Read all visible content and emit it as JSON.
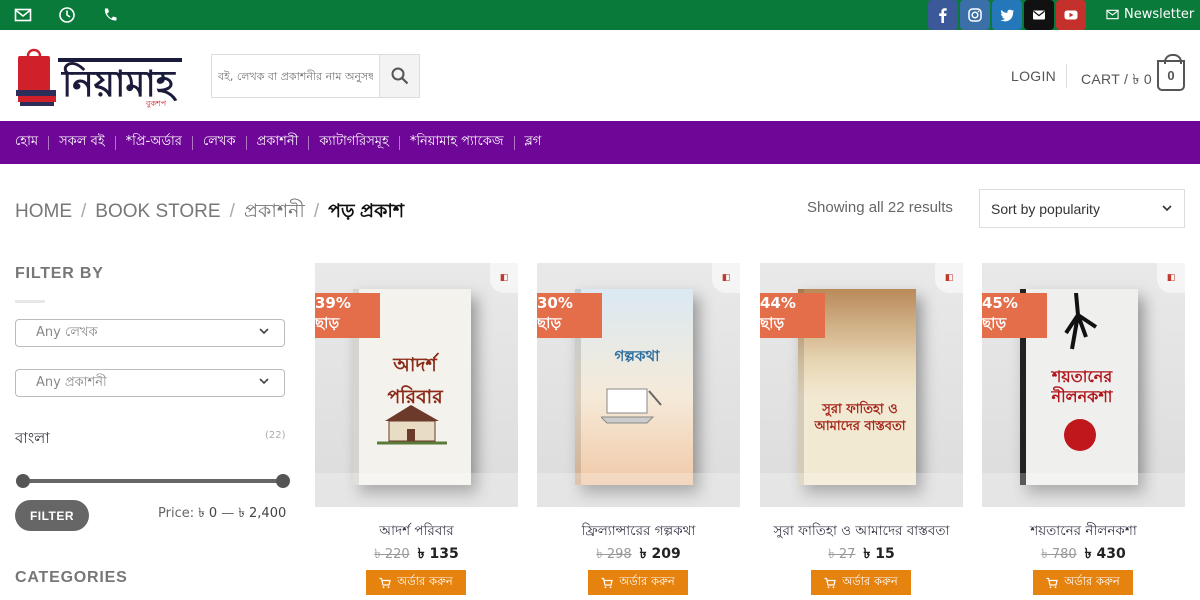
{
  "topbar": {
    "left_icons": [
      "mail-icon",
      "clock-icon",
      "phone-icon"
    ],
    "social": [
      {
        "name": "facebook-icon",
        "color": "#3b5998"
      },
      {
        "name": "instagram-icon",
        "color": "#3b6fa8"
      },
      {
        "name": "twitter-icon",
        "color": "#2478ba"
      },
      {
        "name": "email-icon",
        "color": "#111111"
      },
      {
        "name": "youtube-icon",
        "color": "#c4302b"
      }
    ],
    "newsletter_label": "Newsletter"
  },
  "header": {
    "logo_text": "নিয়ামাহ",
    "logo_subtext": "বুকশপ",
    "search_placeholder": "বই, লেখক বা প্রকাশনীর নাম অনুসন্ধান",
    "login_label": "LOGIN",
    "cart_label": "CART / ৳ 0",
    "cart_count": "0"
  },
  "nav": {
    "items": [
      "হোম",
      "সকল বই",
      "*প্রি-অর্ডার",
      "লেখক",
      "প্রকাশনী",
      "ক্যাটাগরিসমূহ",
      "*নিয়ামাহ প্যাকেজ",
      "ব্লগ"
    ]
  },
  "breadcrumb": {
    "items": [
      "HOME",
      "BOOK STORE",
      "প্রকাশনী"
    ],
    "separator": "/",
    "current": "পড় প্রকাশ"
  },
  "results_text": "Showing all 22 results",
  "sort": {
    "selected": "Sort by popularity"
  },
  "sidebar": {
    "filter_by": "FILTER BY",
    "author_select": "Any লেখক",
    "publisher_select": "Any প্রকাশনী",
    "language": "বাংলা",
    "language_count": "(22)",
    "filter_button": "FILTER",
    "price_label": "Price:",
    "price_min": "৳ 0",
    "price_dash": "—",
    "price_max": "৳ 2,400",
    "categories": "CATEGORIES"
  },
  "products": [
    {
      "name": "আদর্শ পরিবার",
      "old_price": "৳ 220",
      "price": "৳ 135",
      "discount": "39% ছাড়",
      "cover_title": "আদর্শ পরিবার",
      "cover_color": "#f4f2ec",
      "title_color": "#8a2a17"
    },
    {
      "name": "ফ্রিল্যান্সারের গল্পকথা",
      "old_price": "৳ 298",
      "price": "৳ 209",
      "discount": "30% ছাড়",
      "cover_title": "গল্পকথা",
      "cover_color": "#f5ead9",
      "title_color": "#2f6fa0"
    },
    {
      "name": "সুরা ফাতিহা ও আমাদের বাস্তবতা",
      "old_price": "৳ 27",
      "price": "৳ 15",
      "discount": "44% ছাড়",
      "cover_title": "সুরা ফাতিহা ও আমাদের বাস্তবতা",
      "cover_color": "#f2e9d2",
      "title_color": "#a4261a"
    },
    {
      "name": "শয়তানের নীলনকশা",
      "old_price": "৳ 780",
      "price": "৳ 430",
      "discount": "45% ছাড়",
      "cover_title": "শয়তানের নীলনকশা",
      "cover_color": "#efefee",
      "title_color": "#b0161b"
    }
  ],
  "order_button_label": "অর্ডার করুন"
}
